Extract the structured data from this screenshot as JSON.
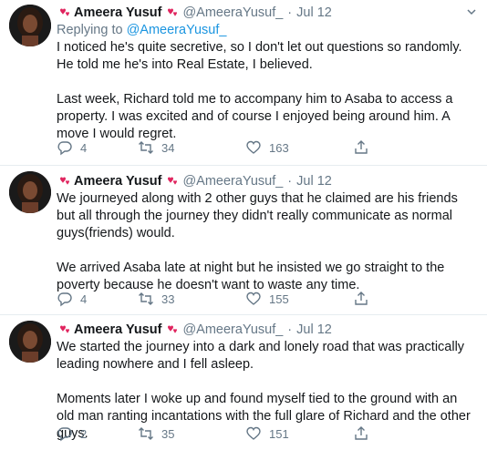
{
  "tweets": [
    {
      "author": "Ameera Yusuf",
      "handle": "@AmeeraYusuf_",
      "dot": "·",
      "date": "Jul 12",
      "replying_prefix": "Replying to ",
      "replying_to": "@AmeeraYusuf_",
      "paragraphs": [
        "I noticed he's quite secretive, so I don't let out questions so randomly. He told me he's into Real Estate, I believed.",
        "Last week, Richard told me to accompany him to Asaba to access a property. I was excited and of course I enjoyed being around him. A move I would regret."
      ],
      "replies": "4",
      "retweets": "34",
      "likes": "163"
    },
    {
      "author": "Ameera Yusuf",
      "handle": "@AmeeraYusuf_",
      "dot": "·",
      "date": "Jul 12",
      "paragraphs": [
        "We journeyed along with 2 other guys that he claimed are his friends but all through the journey they didn't really communicate as normal guys(friends) would.",
        "We arrived Asaba late at night but he insisted we go straight to the poverty because he doesn't want to waste any time."
      ],
      "replies": "4",
      "retweets": "33",
      "likes": "155"
    },
    {
      "author": "Ameera Yusuf",
      "handle": "@AmeeraYusuf_",
      "dot": "·",
      "date": "Jul 12",
      "paragraphs": [
        "We started the journey into a dark and lonely road that was practically leading nowhere and I fell asleep.",
        "Moments later I woke up and found myself tied to the ground with an old man ranting incantations with the full glare of Richard and the other guys."
      ],
      "replies": "2",
      "retweets": "35",
      "likes": "151"
    }
  ],
  "icons": {
    "heart_emoji": "revolving-hearts",
    "reply": "reply-icon",
    "retweet": "retweet-icon",
    "like": "like-icon",
    "share": "share-icon",
    "more": "chevron-down-icon"
  },
  "colors": {
    "text": "#14171a",
    "muted": "#657786",
    "link": "#1b95e0",
    "heart": "#e0245e",
    "divider": "#e6ecf0"
  }
}
